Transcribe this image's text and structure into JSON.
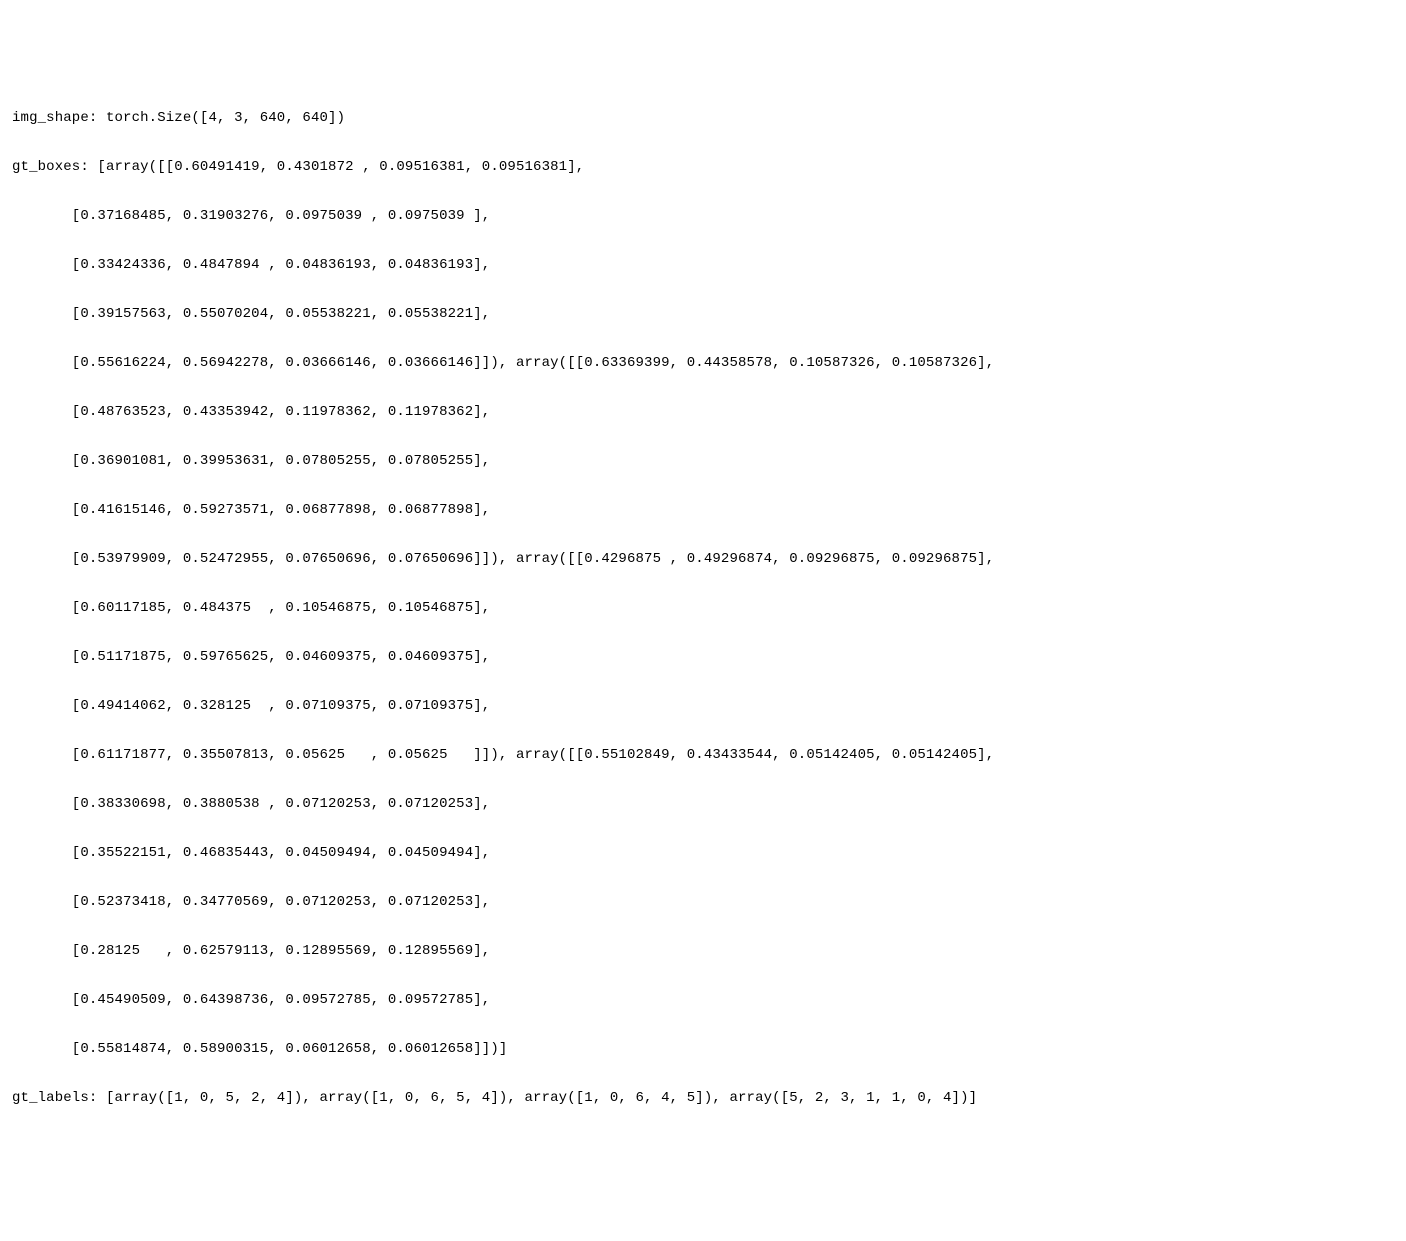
{
  "img_shape": "torch.Size([4, 3, 640, 640])",
  "gt_boxes": [
    [
      [
        0.60491419,
        0.4301872,
        0.09516381,
        0.09516381
      ],
      [
        0.37168485,
        0.31903276,
        0.0975039,
        0.0975039
      ],
      [
        0.33424336,
        0.4847894,
        0.04836193,
        0.04836193
      ],
      [
        0.39157563,
        0.55070204,
        0.05538221,
        0.05538221
      ],
      [
        0.55616224,
        0.56942278,
        0.03666146,
        0.03666146
      ]
    ],
    [
      [
        0.63369399,
        0.44358578,
        0.10587326,
        0.10587326
      ],
      [
        0.48763523,
        0.43353942,
        0.11978362,
        0.11978362
      ],
      [
        0.36901081,
        0.39953631,
        0.07805255,
        0.07805255
      ],
      [
        0.41615146,
        0.59273571,
        0.06877898,
        0.06877898
      ],
      [
        0.53979909,
        0.52472955,
        0.07650696,
        0.07650696
      ]
    ],
    [
      [
        0.4296875,
        0.49296874,
        0.09296875,
        0.09296875
      ],
      [
        0.60117185,
        0.484375,
        0.10546875,
        0.10546875
      ],
      [
        0.51171875,
        0.59765625,
        0.04609375,
        0.04609375
      ],
      [
        0.49414062,
        0.328125,
        0.07109375,
        0.07109375
      ],
      [
        0.61171877,
        0.35507813,
        0.05625,
        0.05625
      ]
    ],
    [
      [
        0.55102849,
        0.43433544,
        0.05142405,
        0.05142405
      ],
      [
        0.38330698,
        0.3880538,
        0.07120253,
        0.07120253
      ],
      [
        0.35522151,
        0.46835443,
        0.04509494,
        0.04509494
      ],
      [
        0.52373418,
        0.34770569,
        0.07120253,
        0.07120253
      ],
      [
        0.28125,
        0.62579113,
        0.12895569,
        0.12895569
      ],
      [
        0.45490509,
        0.64398736,
        0.09572785,
        0.09572785
      ],
      [
        0.55814874,
        0.58900315,
        0.06012658,
        0.06012658
      ]
    ]
  ],
  "gt_labels": [
    [
      1,
      0,
      5,
      2,
      4
    ],
    [
      1,
      0,
      6,
      5,
      4
    ],
    [
      1,
      0,
      6,
      4,
      5
    ],
    [
      5,
      2,
      3,
      1,
      1,
      0,
      4
    ]
  ],
  "rendered_lines": [
    "img_shape: torch.Size([4, 3, 640, 640])",
    "gt_boxes: [array([[0.60491419, 0.4301872 , 0.09516381, 0.09516381],",
    "       [0.37168485, 0.31903276, 0.0975039 , 0.0975039 ],",
    "       [0.33424336, 0.4847894 , 0.04836193, 0.04836193],",
    "       [0.39157563, 0.55070204, 0.05538221, 0.05538221],",
    "       [0.55616224, 0.56942278, 0.03666146, 0.03666146]]), array([[0.63369399, 0.44358578, 0.10587326, 0.10587326],",
    "       [0.48763523, 0.43353942, 0.11978362, 0.11978362],",
    "       [0.36901081, 0.39953631, 0.07805255, 0.07805255],",
    "       [0.41615146, 0.59273571, 0.06877898, 0.06877898],",
    "       [0.53979909, 0.52472955, 0.07650696, 0.07650696]]), array([[0.4296875 , 0.49296874, 0.09296875, 0.09296875],",
    "       [0.60117185, 0.484375  , 0.10546875, 0.10546875],",
    "       [0.51171875, 0.59765625, 0.04609375, 0.04609375],",
    "       [0.49414062, 0.328125  , 0.07109375, 0.07109375],",
    "       [0.61171877, 0.35507813, 0.05625   , 0.05625   ]]), array([[0.55102849, 0.43433544, 0.05142405, 0.05142405],",
    "       [0.38330698, 0.3880538 , 0.07120253, 0.07120253],",
    "       [0.35522151, 0.46835443, 0.04509494, 0.04509494],",
    "       [0.52373418, 0.34770569, 0.07120253, 0.07120253],",
    "       [0.28125   , 0.62579113, 0.12895569, 0.12895569],",
    "       [0.45490509, 0.64398736, 0.09572785, 0.09572785],",
    "       [0.55814874, 0.58900315, 0.06012658, 0.06012658]])]",
    "gt_labels: [array([1, 0, 5, 2, 4]), array([1, 0, 6, 5, 4]), array([1, 0, 6, 4, 5]), array([5, 2, 3, 1, 1, 0, 4])]"
  ]
}
